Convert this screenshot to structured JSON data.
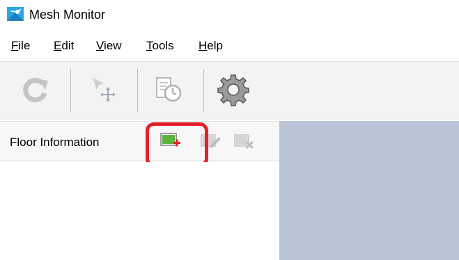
{
  "window": {
    "title": "Mesh Monitor",
    "icon": "mesh-app-icon"
  },
  "menu": {
    "items": [
      {
        "label": "File",
        "mnemonic": "F",
        "rest": "ile"
      },
      {
        "label": "Edit",
        "mnemonic": "E",
        "rest": "dit"
      },
      {
        "label": "View",
        "mnemonic": "V",
        "rest": "iew"
      },
      {
        "label": "Tools",
        "mnemonic": "T",
        "rest": "ools"
      },
      {
        "label": "Help",
        "mnemonic": "H",
        "rest": "elp"
      }
    ]
  },
  "toolbar": {
    "buttons": [
      {
        "icon": "refresh-icon",
        "enabled": false
      },
      {
        "icon": "move-cursor-icon",
        "enabled": false
      },
      {
        "icon": "history-icon",
        "enabled": false
      },
      {
        "icon": "gear-icon",
        "enabled": true
      }
    ]
  },
  "panel": {
    "title": "Floor Information",
    "buttons": [
      {
        "icon": "add-floor-icon",
        "enabled": true,
        "highlighted": true
      },
      {
        "icon": "edit-floor-icon",
        "enabled": false
      },
      {
        "icon": "delete-floor-icon",
        "enabled": false
      }
    ]
  },
  "colors": {
    "highlight": "#e3202a",
    "floor_green": "#5db33b",
    "canvas_bg": "#b9c5d6",
    "toolbar_bg": "#f3f3f3"
  }
}
